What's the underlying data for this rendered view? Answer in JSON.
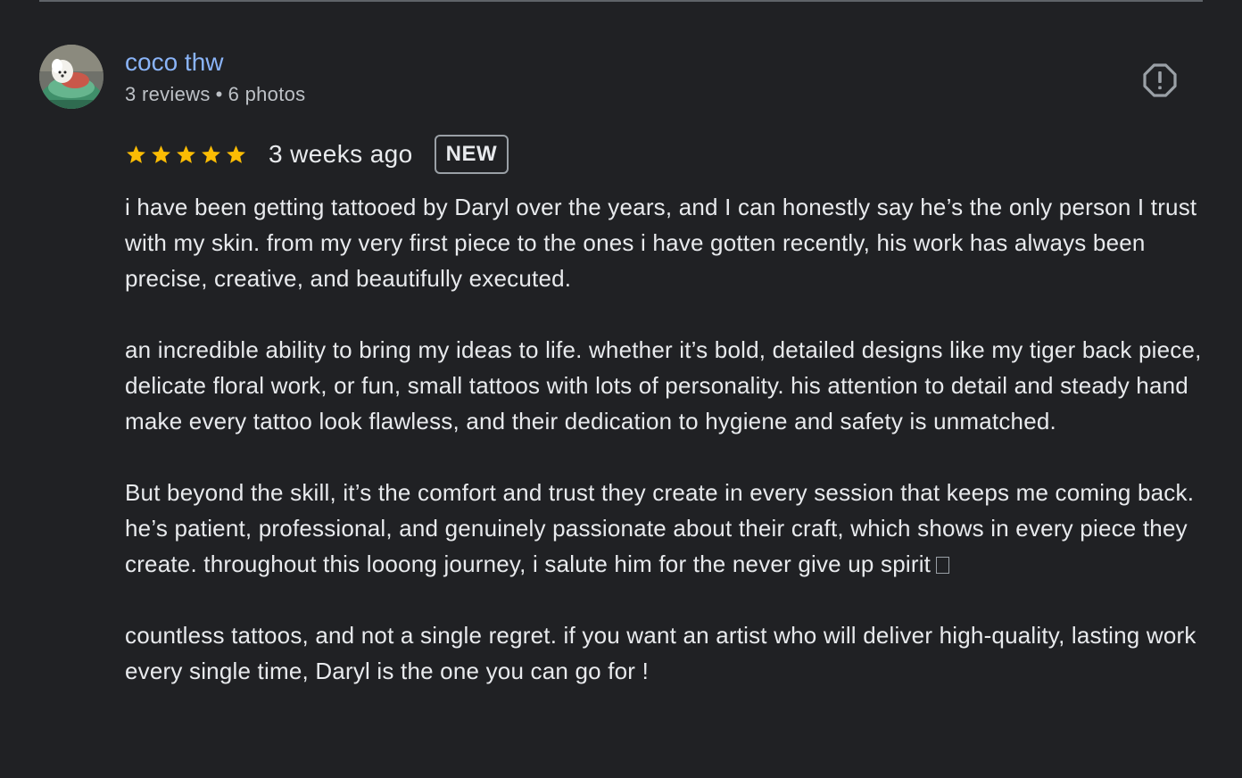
{
  "review": {
    "author": {
      "name": "coco thw",
      "reviews_count": "3 reviews",
      "separator": "•",
      "photos_count": "6 photos",
      "avatar_icon": "avatar-photo"
    },
    "rating": 5,
    "rating_max": 5,
    "time_ago": "3 weeks ago",
    "badge": "NEW",
    "report_icon": "report-icon",
    "colors": {
      "author_name": "#8ab4f8",
      "star": "#fbbc04",
      "background": "#202124",
      "text": "#e8eaed"
    },
    "paragraphs": [
      "i have been getting tattooed by Daryl over the years, and I can honestly say he’s the only person I trust with my skin. from my very first piece to the ones i have gotten recently, his work has always been precise, creative, and beautifully executed.",
      "an incredible ability to bring my ideas to life. whether it’s bold, detailed designs like my tiger back piece, delicate floral work, or fun, small tattoos with lots of personality. his attention to detail and steady hand make every tattoo look flawless, and their dedication to hygiene and safety is unmatched.",
      "But beyond the skill, it’s the comfort and trust they create in every session that keeps me coming back. he’s patient, professional, and genuinely passionate about their craft, which shows in every piece they create. throughout this looong journey, i salute him for the never give up spirit",
      "countless tattoos, and not a single regret. if you want an artist who will deliver high-quality, lasting work every single time, Daryl is the one you can go for !"
    ]
  }
}
